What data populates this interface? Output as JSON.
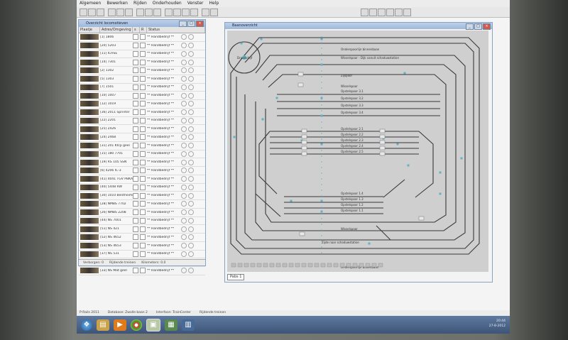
{
  "menu": [
    "Algemeen",
    "Bewerken",
    "Rijden",
    "Onderhouden",
    "Venster",
    "Help"
  ],
  "loc_window": {
    "title": "Overzicht locomotieven",
    "columns": [
      "Plaatje",
      "Adres/Omgeving",
      "s",
      "R",
      "Status"
    ],
    "locs": [
      {
        "name": "[1] 1806",
        "status": "** Handbedrijf **"
      },
      {
        "name": "[20] 5203",
        "status": "** Handbedrijf **"
      },
      {
        "name": "[11] ICHSE",
        "status": "** Handbedrijf **"
      },
      {
        "name": "[14] 7301",
        "status": "** Handbedrijf **"
      },
      {
        "name": "[2] 1302",
        "status": "** Handbedrijf **"
      },
      {
        "name": "[5] 1303",
        "status": "** Handbedrijf **"
      },
      {
        "name": "[7] 1501",
        "status": "** Handbedrijf **"
      },
      {
        "name": "[10] 1007",
        "status": "** Handbedrijf **"
      },
      {
        "name": "[12] 1019",
        "status": "** Handbedrijf **"
      },
      {
        "name": "[36] 2011 Sprinter",
        "status": "** Handbedrijf **"
      },
      {
        "name": "[22] 2201",
        "status": "** Handbedrijf **"
      },
      {
        "name": "[25] 2426",
        "status": "** Handbedrijf **"
      },
      {
        "name": "[24] 2468",
        "status": "** Handbedrijf **"
      },
      {
        "name": "[31] 201 Ktcp geel",
        "status": "** Handbedrijf **"
      },
      {
        "name": "[15] 180 7701",
        "status": "** Handbedrijf **"
      },
      {
        "name": "[19] RS 105 SSN",
        "status": "** Handbedrijf **"
      },
      {
        "name": "[6] 4206 IC-3",
        "status": "** Handbedrijf **"
      },
      {
        "name": "[41] 4041 TGV PBKA",
        "status": "** Handbedrijf **"
      },
      {
        "name": "[40] 5448 RW",
        "status": "** Handbedrijf **"
      },
      {
        "name": "[30] 1010 Bentheimer",
        "status": "** Handbedrijf **"
      },
      {
        "name": "[28] NMBS 7702",
        "status": "** Handbedrijf **"
      },
      {
        "name": "[26] NMBS 2208",
        "status": "** Handbedrijf **"
      },
      {
        "name": "[44] NS 7001",
        "status": "** Handbedrijf **"
      },
      {
        "name": "[51] NS 421",
        "status": "** Handbedrijf **"
      },
      {
        "name": "[52] NS 4652",
        "status": "** Handbedrijf **"
      },
      {
        "name": "[53] NS 4653",
        "status": "** Handbedrijf **"
      },
      {
        "name": "[37] NS 531",
        "status": "** Handbedrijf **"
      },
      {
        "name": "[46] NS 5466",
        "status": "** Handbedrijf **"
      },
      {
        "name": "[33] NS Mat geel",
        "status": "** Handbedrijf **"
      }
    ],
    "footer": [
      "Verborgen: 0",
      "Rijdende treinen",
      "Kilometers: 0.0"
    ]
  },
  "track_window": {
    "title": "Baanoverzicht",
    "tab": "Pabs 1",
    "turntable": "Draaischijf",
    "labels": [
      "Onderspoorlijn binnenbaan",
      "Wisselspoor - Dijk vanuit schaduwstation",
      "Zijspoor",
      "Wisselspoor",
      "Opstelspoor 3.1",
      "Opstelspoor 3.2",
      "Opstelspoor 3.3",
      "Opstelspoor 3.4",
      "Opstelspoor 2.1",
      "Opstelspoor 2.2",
      "Opstelspoor 2.3",
      "Opstelspoor 2.4",
      "Opstelspoor 2.5",
      "Opstelspoor 1.4",
      "Opstelspoor 1.3",
      "Opstelspoor 1.2",
      "Opstelspoor 1.1",
      "Wisselspoor",
      "Zijde naar schaduwstation",
      "Onderspoorlijn buitenbaan"
    ]
  },
  "statusbar": [
    "P-Rails 2011",
    "Database: Zwolle baan 2",
    "Interface: TrainCenter",
    "Rijdende treinen"
  ],
  "taskbar": {
    "time": "20:44",
    "date": "27-8-2012"
  },
  "colors": {
    "accent": "#5fb3c4",
    "track": "#3a3a3a",
    "canvas": "#cfcfcf"
  }
}
